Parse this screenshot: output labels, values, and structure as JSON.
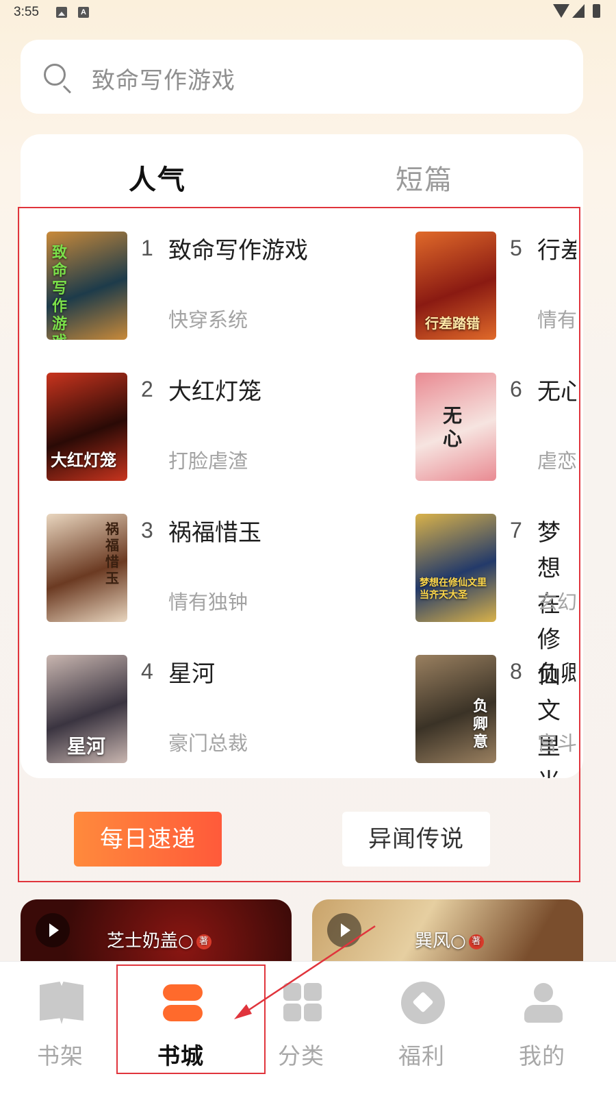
{
  "status_bar": {
    "time": "3:55",
    "indicator_a": "A"
  },
  "search": {
    "placeholder": "致命写作游戏"
  },
  "tabs": [
    {
      "label": "人气",
      "active": true
    },
    {
      "label": "短篇",
      "active": false
    }
  ],
  "books": [
    {
      "rank": "1",
      "title": "致命写作游戏",
      "tag": "快穿系统",
      "cover_text": "致命写作游戏",
      "cover_colors": [
        "#1d3b4a",
        "#c98a3a"
      ]
    },
    {
      "rank": "2",
      "title": "大红灯笼",
      "tag": "打脸虐渣",
      "cover_text": "大红灯笼",
      "cover_colors": [
        "#2a0a06",
        "#c8341e"
      ]
    },
    {
      "rank": "3",
      "title": "祸福惜玉",
      "tag": "情有独钟",
      "cover_text": "祸福惜玉",
      "cover_colors": [
        "#6b3a22",
        "#e9d6bf"
      ]
    },
    {
      "rank": "4",
      "title": "星河",
      "tag": "豪门总裁",
      "cover_text": "星河",
      "cover_colors": [
        "#3a3440",
        "#c9b6b0"
      ]
    },
    {
      "rank": "5",
      "title": "行差踏错",
      "tag": "情有独钟",
      "cover_text": "行差踏错",
      "cover_colors": [
        "#8a1a12",
        "#e06a2a"
      ]
    },
    {
      "rank": "6",
      "title": "无心",
      "tag": "虐恋",
      "cover_text": "无心",
      "cover_colors": [
        "#f6e4e0",
        "#e98a92"
      ]
    },
    {
      "rank": "7",
      "title": "梦想在修仙文里当齐天大圣",
      "tag": "玄幻",
      "cover_text": "梦想在修仙文里当齐天大圣",
      "cover_colors": [
        "#233a6a",
        "#d9b24a"
      ]
    },
    {
      "rank": "8",
      "title": "负卿意",
      "tag": "宫斗",
      "cover_text": "负卿意",
      "cover_colors": [
        "#3a3226",
        "#9a8060"
      ]
    }
  ],
  "chips": {
    "daily": "每日速递",
    "legend": "异闻传说"
  },
  "video_cards": [
    {
      "author": "芝士奶盖○",
      "badge": "著"
    },
    {
      "author": "巽风○",
      "badge": "著"
    }
  ],
  "nav": [
    {
      "label": "书架",
      "icon": "bookshelf-icon",
      "active": false
    },
    {
      "label": "书城",
      "icon": "bookstore-icon",
      "active": true
    },
    {
      "label": "分类",
      "icon": "category-icon",
      "active": false
    },
    {
      "label": "福利",
      "icon": "welfare-icon",
      "active": false
    },
    {
      "label": "我的",
      "icon": "profile-icon",
      "active": false
    }
  ],
  "colors": {
    "accent": "#ff6a2c",
    "highlight_red": "#e0343c"
  }
}
